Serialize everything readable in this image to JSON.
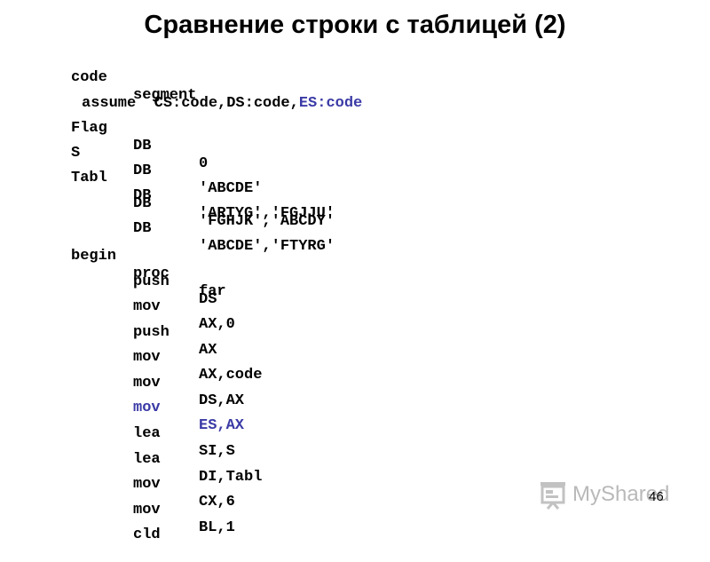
{
  "slide": {
    "title": "Сравнение строки с таблицей (2)",
    "page_number": "46"
  },
  "watermark": {
    "text": "MyShared"
  },
  "colors": {
    "text": "#000000",
    "highlight": "#3a3aa6",
    "watermark": "#b9b9b9"
  },
  "code": {
    "line1": {
      "c1": "code",
      "c2": "segment"
    },
    "line2": {
      "part1": "assume  CS:code,DS:code,",
      "part2": "ES:code"
    },
    "line3": {
      "c1": "Flag",
      "c2": "DB",
      "c3": "0"
    },
    "line4": {
      "c1": "S",
      "c2": "DB",
      "c3": "'ABCDE'"
    },
    "line5": {
      "c1": "Tabl",
      "c2": "DB",
      "c3": "'ARTYG','FGJJU'"
    },
    "line6": {
      "c2": "DB",
      "c3": "'FGHJK','ABCDY'"
    },
    "line7": {
      "c2": "DB",
      "c3": "'ABCDE','FTYRG'"
    },
    "line8": {
      "c1": "begin",
      "c2": "proc",
      "c3": "far"
    },
    "line9": {
      "c2": "push",
      "c3": "DS"
    },
    "line10": {
      "c2": "mov",
      "c3": "AX,0"
    },
    "line11": {
      "c2": "push",
      "c3": "AX"
    },
    "line12": {
      "c2": "mov",
      "c3": "AX,code"
    },
    "line13": {
      "c2": "mov",
      "c3": "DS,AX"
    },
    "line14": {
      "c2": "mov",
      "c3": "ES,AX"
    },
    "line15": {
      "c2": "lea",
      "c3": "SI,S"
    },
    "line16": {
      "c2": "lea",
      "c3": "DI,Tabl"
    },
    "line17": {
      "c2": "mov",
      "c3": "CX,6"
    },
    "line18": {
      "c2": "mov",
      "c3": "BL,1"
    },
    "line19": {
      "c2": "cld"
    }
  }
}
